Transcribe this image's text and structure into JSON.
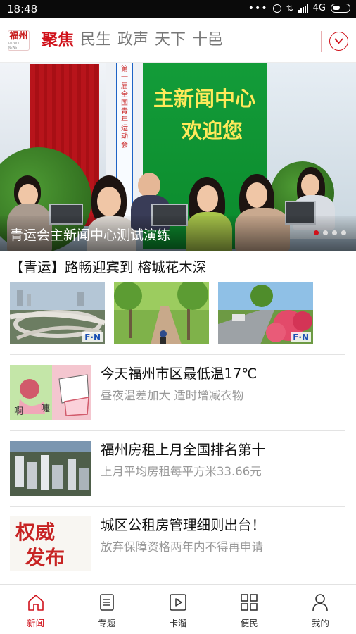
{
  "status_bar": {
    "time": "18:48",
    "network": "4G"
  },
  "header": {
    "logo_text": "福州",
    "logo_subtext": "FUZHOU NEWS",
    "tabs": [
      {
        "label": "聚焦",
        "active": true
      },
      {
        "label": "民生",
        "active": false
      },
      {
        "label": "政声",
        "active": false
      },
      {
        "label": "天下",
        "active": false
      },
      {
        "label": "十邑",
        "active": false
      }
    ],
    "more_icon": "chevron-down-circle-icon"
  },
  "banner": {
    "board_line1": "主新闻中心",
    "board_line2": "欢迎您",
    "pillar_text": "第一届全国青年运动会",
    "caption": "青运会主新闻中心测试演练",
    "slide_count": 4,
    "active_slide": 1
  },
  "feature": {
    "title": "【青运】路畅迎宾到 榕城花木深",
    "thumbs": [
      {
        "badge": "F·N"
      },
      {
        "badge": ""
      },
      {
        "badge": "F·N"
      }
    ]
  },
  "news": [
    {
      "title": "今天福州市区最低温17℃",
      "subtitle": "昼夜温差加大 适时增减衣物",
      "thumb_text_1": "啊",
      "thumb_text_2": "嚏"
    },
    {
      "title": "福州房租上月全国排名第十",
      "subtitle": "上月平均房租每平方米33.66元"
    },
    {
      "title": "城区公租房管理细则出台！",
      "subtitle": "放弃保障资格两年内不得再申请",
      "thumb_text_1": "权威",
      "thumb_text_2": "发布"
    }
  ],
  "bottom_nav": [
    {
      "label": "新闻",
      "icon": "home-icon",
      "active": true
    },
    {
      "label": "专题",
      "icon": "document-icon",
      "active": false
    },
    {
      "label": "卡溜",
      "icon": "play-icon",
      "active": false
    },
    {
      "label": "便民",
      "icon": "grid-icon",
      "active": false
    },
    {
      "label": "我的",
      "icon": "person-icon",
      "active": false
    }
  ],
  "colors": {
    "accent": "#d0121b",
    "text": "#111111",
    "subtext": "#999999"
  }
}
